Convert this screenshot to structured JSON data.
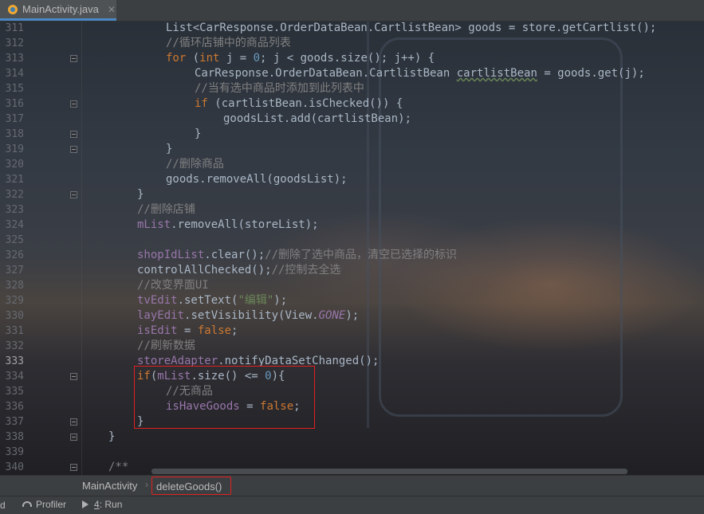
{
  "editor_tab": {
    "file_name": "MainActivity.java",
    "close_glyph": "✕",
    "icon": "java-class-icon",
    "accent": "#4a88c7"
  },
  "current_line": "333",
  "highlight_color": "#e02020",
  "lines": [
    {
      "num": "311",
      "indent": 3,
      "fold": false,
      "tokens": [
        [
          "t",
          "List<CarResponse.OrderDataBean.CartlistBean> goods = store.getCartlist();"
        ]
      ]
    },
    {
      "num": "312",
      "indent": 3,
      "fold": false,
      "tokens": [
        [
          "cm",
          "//循环店铺中的商品列表"
        ]
      ]
    },
    {
      "num": "313",
      "indent": 3,
      "fold": true,
      "tokens": [
        [
          "kw",
          "for"
        ],
        [
          "t",
          " ("
        ],
        [
          "kw",
          "int"
        ],
        [
          "t",
          " j = "
        ],
        [
          "num",
          "0"
        ],
        [
          "t",
          "; j < goods.size(); j++) {"
        ]
      ]
    },
    {
      "num": "314",
      "indent": 4,
      "fold": false,
      "tokens": [
        [
          "t",
          "CarResponse.OrderDataBean.CartlistBean "
        ],
        [
          "typo",
          "cartlistBean"
        ],
        [
          "t",
          " = goods.get(j);"
        ]
      ]
    },
    {
      "num": "315",
      "indent": 4,
      "fold": false,
      "tokens": [
        [
          "cm",
          "//当有选中商品时添加到此列表中"
        ]
      ]
    },
    {
      "num": "316",
      "indent": 4,
      "fold": true,
      "tokens": [
        [
          "kw",
          "if"
        ],
        [
          "t",
          " (cartlistBean.isChecked()) {"
        ]
      ]
    },
    {
      "num": "317",
      "indent": 5,
      "fold": false,
      "tokens": [
        [
          "t",
          "goodsList.add(cartlistBean);"
        ]
      ]
    },
    {
      "num": "318",
      "indent": 4,
      "fold": true,
      "tokens": [
        [
          "t",
          "}"
        ]
      ]
    },
    {
      "num": "319",
      "indent": 3,
      "fold": true,
      "tokens": [
        [
          "t",
          "}"
        ]
      ]
    },
    {
      "num": "320",
      "indent": 3,
      "fold": false,
      "tokens": [
        [
          "cm",
          "//删除商品"
        ]
      ]
    },
    {
      "num": "321",
      "indent": 3,
      "fold": false,
      "tokens": [
        [
          "t",
          "goods.removeAll(goodsList);"
        ]
      ]
    },
    {
      "num": "322",
      "indent": 2,
      "fold": true,
      "tokens": [
        [
          "t",
          "}"
        ]
      ]
    },
    {
      "num": "323",
      "indent": 2,
      "fold": false,
      "tokens": [
        [
          "cm",
          "//删除店铺"
        ]
      ]
    },
    {
      "num": "324",
      "indent": 2,
      "fold": false,
      "tokens": [
        [
          "fld",
          "mList"
        ],
        [
          "t",
          ".removeAll(storeList);"
        ]
      ]
    },
    {
      "num": "325",
      "indent": 2,
      "fold": false,
      "tokens": []
    },
    {
      "num": "326",
      "indent": 2,
      "fold": false,
      "tokens": [
        [
          "fld",
          "shopIdList"
        ],
        [
          "t",
          ".clear();"
        ],
        [
          "cm",
          "//删除了选中商品，清空已选择的标识"
        ]
      ]
    },
    {
      "num": "327",
      "indent": 2,
      "fold": false,
      "tokens": [
        [
          "t",
          "controlAllChecked();"
        ],
        [
          "cm",
          "//控制去全选"
        ]
      ]
    },
    {
      "num": "328",
      "indent": 2,
      "fold": false,
      "tokens": [
        [
          "cm",
          "//改变界面UI"
        ]
      ]
    },
    {
      "num": "329",
      "indent": 2,
      "fold": false,
      "tokens": [
        [
          "fld",
          "tvEdit"
        ],
        [
          "t",
          ".setText("
        ],
        [
          "str",
          "\"编辑\""
        ],
        [
          "t",
          ");"
        ]
      ]
    },
    {
      "num": "330",
      "indent": 2,
      "fold": false,
      "tokens": [
        [
          "fld",
          "layEdit"
        ],
        [
          "t",
          ".setVisibility(View."
        ],
        [
          "fi",
          "GONE"
        ],
        [
          "t",
          ");"
        ]
      ]
    },
    {
      "num": "331",
      "indent": 2,
      "fold": false,
      "tokens": [
        [
          "fld",
          "isEdit"
        ],
        [
          "t",
          " = "
        ],
        [
          "kw",
          "false"
        ],
        [
          "t",
          ";"
        ]
      ]
    },
    {
      "num": "332",
      "indent": 2,
      "fold": false,
      "tokens": [
        [
          "cm",
          "//刷新数据"
        ]
      ]
    },
    {
      "num": "333",
      "indent": 2,
      "fold": false,
      "tokens": [
        [
          "fld",
          "storeAdapter"
        ],
        [
          "t",
          ".notifyDataSetChanged();"
        ]
      ]
    },
    {
      "num": "334",
      "indent": 2,
      "fold": true,
      "tokens": [
        [
          "kw",
          "if"
        ],
        [
          "t",
          "("
        ],
        [
          "fld",
          "mList"
        ],
        [
          "t",
          ".size() <= "
        ],
        [
          "num",
          "0"
        ],
        [
          "t",
          "){"
        ]
      ]
    },
    {
      "num": "335",
      "indent": 3,
      "fold": false,
      "tokens": [
        [
          "cm",
          "//无商品"
        ]
      ]
    },
    {
      "num": "336",
      "indent": 3,
      "fold": false,
      "tokens": [
        [
          "fld",
          "isHaveGoods"
        ],
        [
          "t",
          " = "
        ],
        [
          "kw",
          "false"
        ],
        [
          "t",
          ";"
        ]
      ]
    },
    {
      "num": "337",
      "indent": 2,
      "fold": true,
      "tokens": [
        [
          "t",
          "}"
        ]
      ]
    },
    {
      "num": "338",
      "indent": 1,
      "fold": true,
      "tokens": [
        [
          "t",
          "}"
        ]
      ]
    },
    {
      "num": "339",
      "indent": 1,
      "fold": false,
      "tokens": []
    },
    {
      "num": "340",
      "indent": 1,
      "fold": true,
      "tokens": [
        [
          "cm",
          "/**"
        ]
      ]
    }
  ],
  "breadcrumb": {
    "class_name": "MainActivity",
    "separator": "›",
    "method_name": "deleteGoods()"
  },
  "tool_windows": {
    "partial_label": "d",
    "profiler": {
      "label": "Profiler",
      "icon": "profiler-gauge-icon"
    },
    "run": {
      "number": "4",
      "label": ": Run",
      "icon": "run-play-icon"
    }
  }
}
